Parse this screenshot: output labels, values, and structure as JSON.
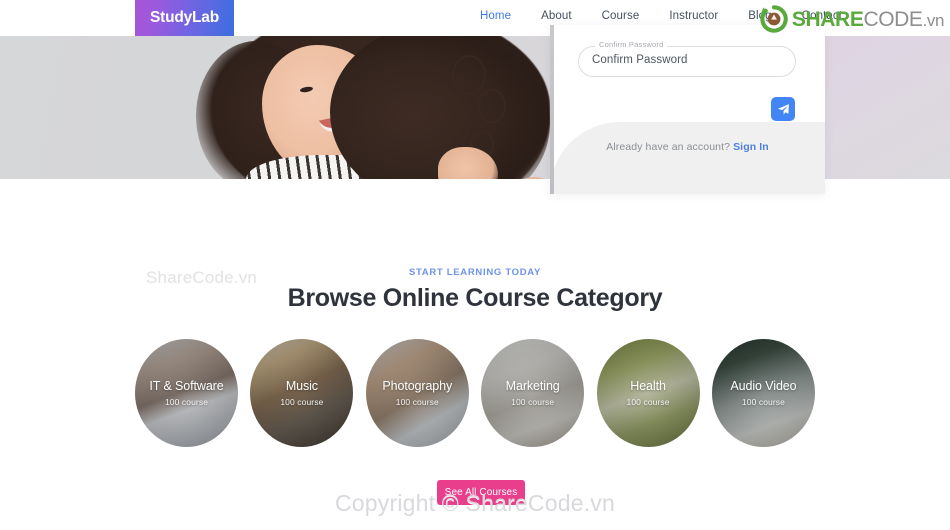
{
  "brand": {
    "name": "StudyLab"
  },
  "nav": {
    "items": [
      {
        "label": "Home",
        "active": true
      },
      {
        "label": "About",
        "active": false
      },
      {
        "label": "Course",
        "active": false
      },
      {
        "label": "Instructor",
        "active": false
      },
      {
        "label": "Blog",
        "active": false
      },
      {
        "label": "Contact",
        "active": false
      }
    ]
  },
  "watermark": {
    "logo_share": "SHARE",
    "logo_code": "CODE",
    "logo_vn": ".vn",
    "left_text": "ShareCode.vn",
    "bottom_text": "Copyright © ShareCode.vn"
  },
  "signup_modal": {
    "confirm_password": {
      "label": "Confirm Password",
      "value": "Confirm Password",
      "placeholder": "Confirm Password"
    },
    "submit_icon": "send-icon",
    "footer_text": "Already have an account?",
    "signin_link": "Sign In"
  },
  "category_section": {
    "eyebrow": "START LEARNING TODAY",
    "title": "Browse Online Course Category",
    "cta_label": "See All Courses",
    "cards": [
      {
        "name": "IT & Software",
        "count": "100 course"
      },
      {
        "name": "Music",
        "count": "100 course"
      },
      {
        "name": "Photography",
        "count": "100 course"
      },
      {
        "name": "Marketing",
        "count": "100 course"
      },
      {
        "name": "Health",
        "count": "100 course"
      },
      {
        "name": "Audio Video",
        "count": "100 course"
      }
    ]
  },
  "colors": {
    "brand_gradient_start": "#a855d8",
    "brand_gradient_end": "#3b6fe0",
    "nav_active": "#3b7ddd",
    "eyebrow": "#6f93e8",
    "cta_pink": "#e83e8c",
    "send_blue": "#4285f4",
    "link_blue": "#4c7fe0",
    "sharecode_green": "#5aa93d",
    "sharecode_gray": "#8e8e8e"
  }
}
